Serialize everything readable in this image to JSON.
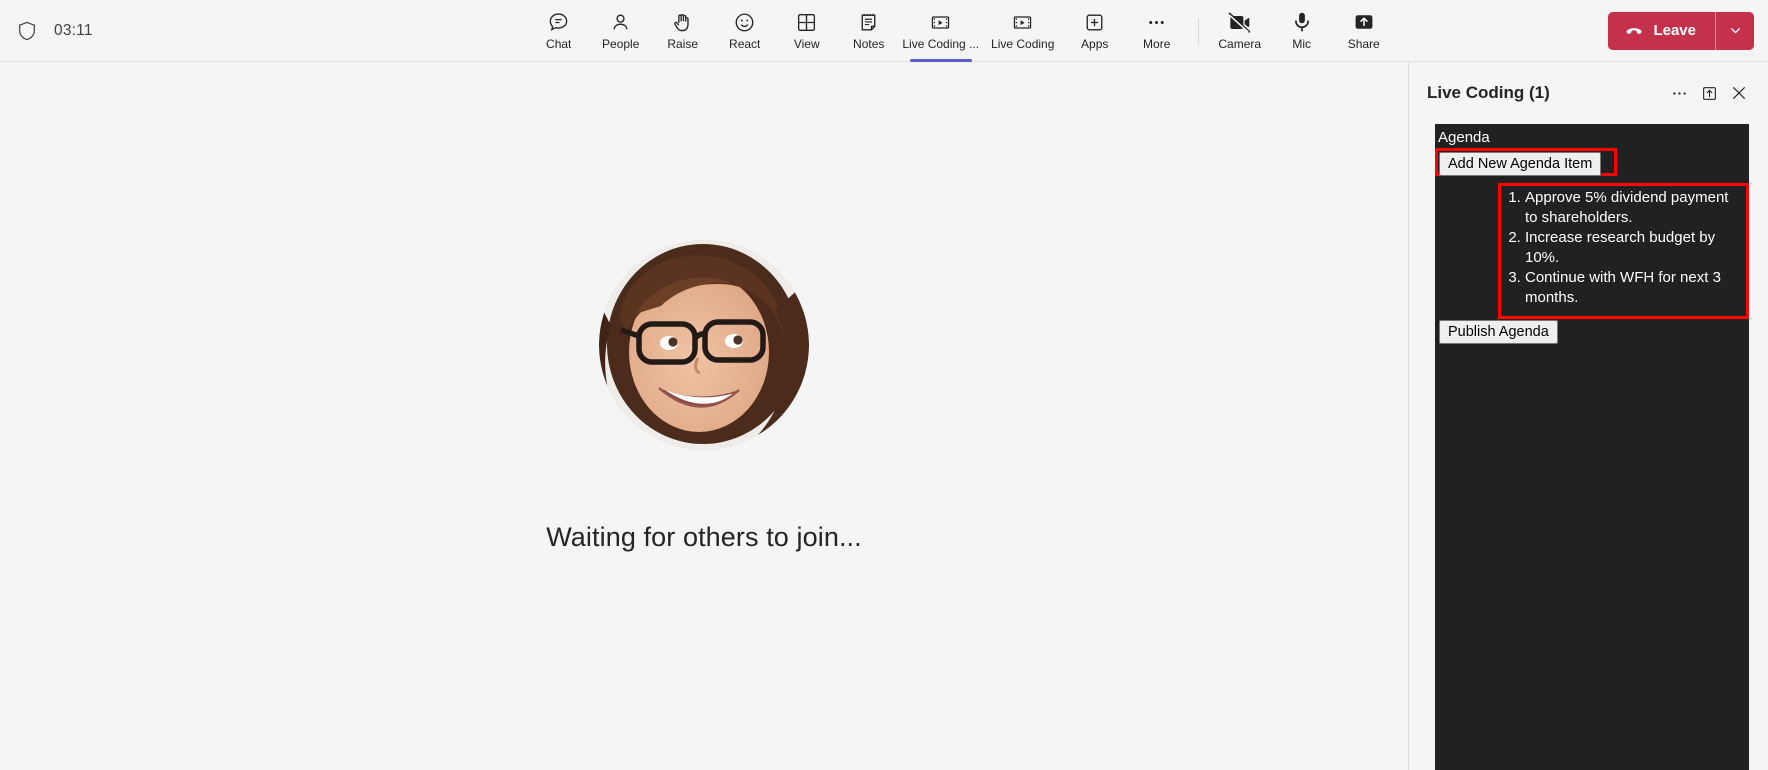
{
  "topbar": {
    "security_icon": "shield-icon",
    "timer": "03:11",
    "tools": [
      {
        "label": "Chat",
        "icon": "chat-icon",
        "active": false
      },
      {
        "label": "People",
        "icon": "people-icon",
        "active": false
      },
      {
        "label": "Raise",
        "icon": "raise-hand-icon",
        "active": false
      },
      {
        "label": "React",
        "icon": "react-smiley-icon",
        "active": false
      },
      {
        "label": "View",
        "icon": "view-grid-icon",
        "active": false
      },
      {
        "label": "Notes",
        "icon": "notes-icon",
        "active": false
      },
      {
        "label": "Live Coding ...",
        "icon": "live-coding-icon",
        "active": true
      },
      {
        "label": "Live Coding",
        "icon": "live-coding-icon",
        "active": false
      },
      {
        "label": "Apps",
        "icon": "apps-plus-icon",
        "active": false
      },
      {
        "label": "More",
        "icon": "more-ellipsis-icon",
        "active": false
      }
    ],
    "device_controls": [
      {
        "label": "Camera",
        "icon": "camera-off-icon"
      },
      {
        "label": "Mic",
        "icon": "mic-icon"
      },
      {
        "label": "Share",
        "icon": "share-screen-icon"
      }
    ],
    "leave_label": "Leave",
    "leave_icon": "hangup-icon",
    "leave_caret_icon": "chevron-down-icon",
    "accent_color": "#5b5fc7",
    "leave_color": "#c4314b"
  },
  "stage": {
    "avatar_name": "participant-avatar",
    "waiting_text": "Waiting for others to join..."
  },
  "panel": {
    "title": "Live Coding (1)",
    "more_icon": "more-ellipsis-icon",
    "popout_icon": "pop-out-icon",
    "close_icon": "close-icon",
    "agenda": {
      "heading": "Agenda",
      "add_button": "Add New Agenda Item",
      "publish_button": "Publish Agenda",
      "items": [
        "Approve 5% dividend payment to shareholders.",
        "Increase research budget by 10%.",
        "Continue with WFH for next 3 months."
      ],
      "highlight_color": "#ff0000",
      "surface_color": "#212121"
    }
  }
}
